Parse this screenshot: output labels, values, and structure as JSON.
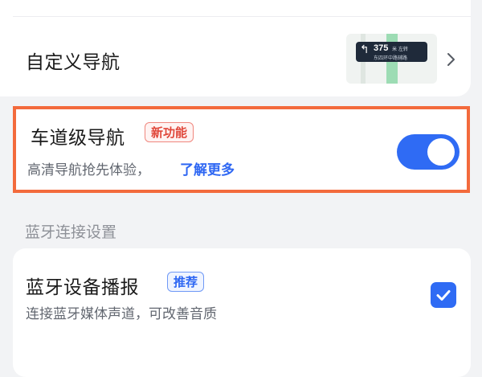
{
  "custom_nav": {
    "label": "自定义导航",
    "preview": {
      "turn_icon": "turn-left-arrow-icon",
      "distance": "375",
      "unit": "米 左转",
      "road_name": "东四环中路辅路"
    },
    "chevron_icon": "chevron-right-icon"
  },
  "lane_nav": {
    "title": "车道级导航",
    "badge": "新功能",
    "subtitle": "高清导航抢先体验，",
    "link": "了解更多",
    "toggle_on": true,
    "highlight_color": "#f36a3c"
  },
  "bluetooth_section": {
    "header": "蓝牙连接设置",
    "item": {
      "title": "蓝牙设备播报",
      "badge": "推荐",
      "subtitle": "连接蓝牙媒体声道，可改善音质",
      "checked": true
    }
  },
  "colors": {
    "accent": "#2f6bf4",
    "background": "#f2f3f5",
    "new_badge": "#e0473a"
  }
}
